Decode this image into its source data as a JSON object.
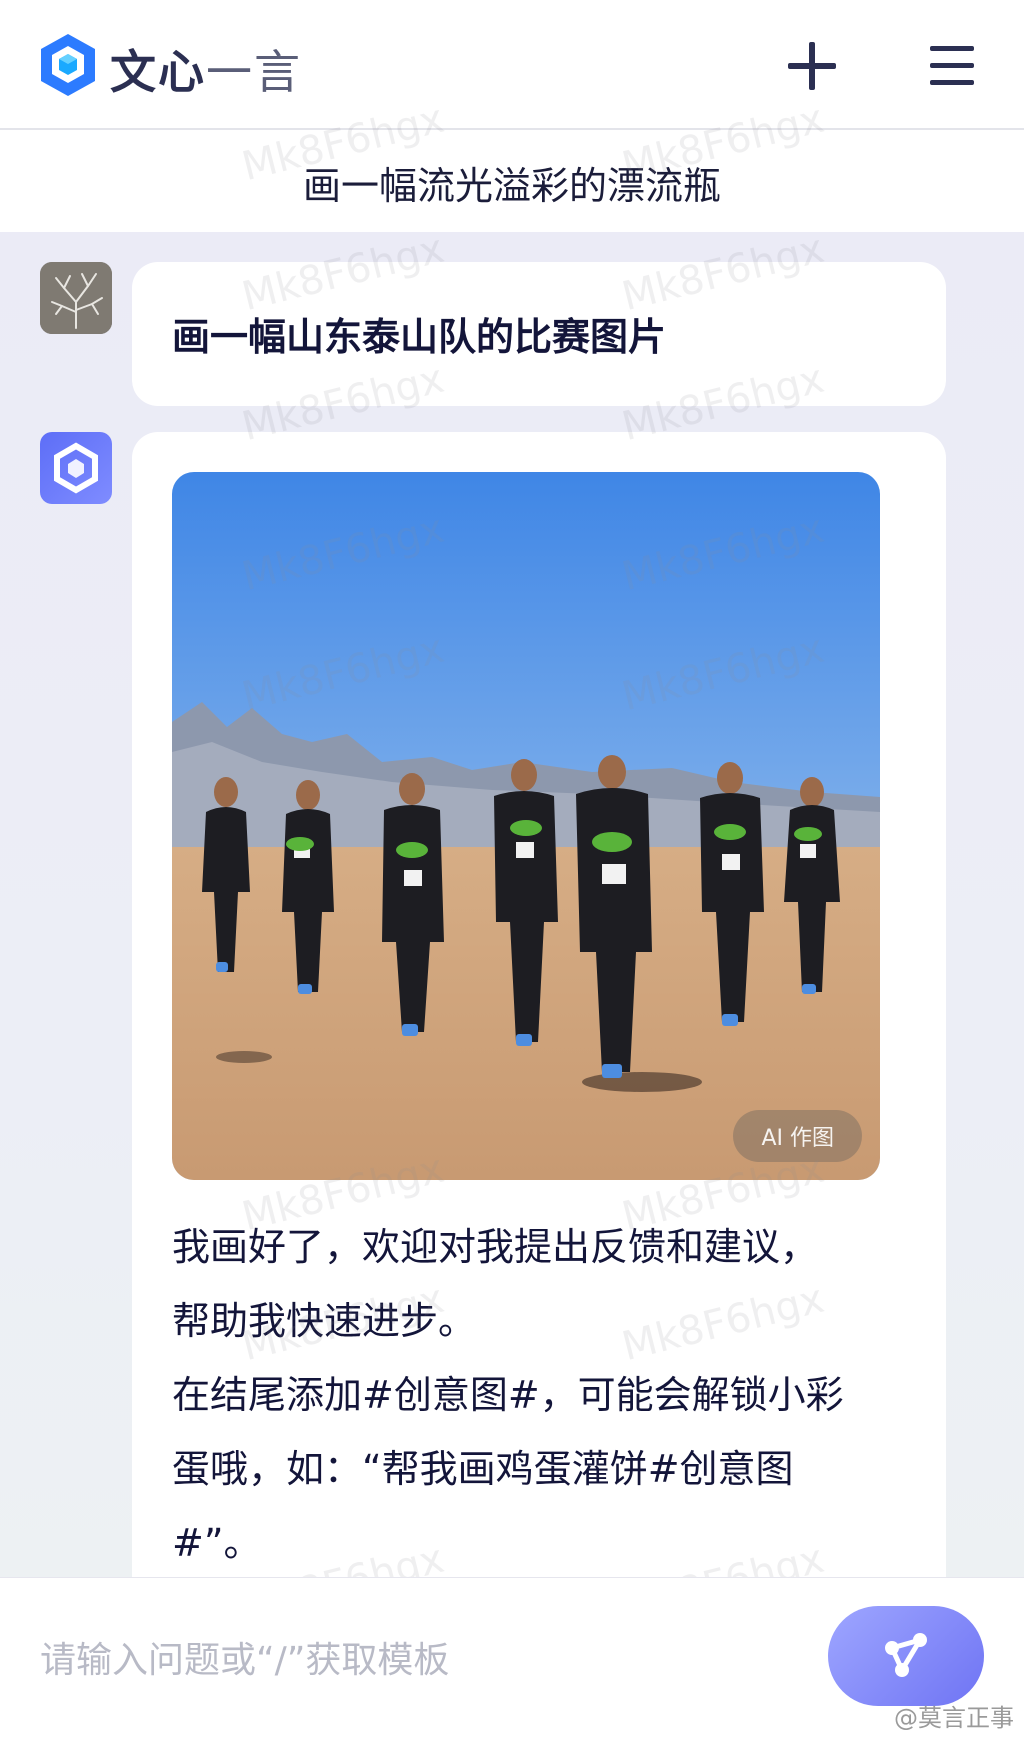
{
  "header": {
    "brand_bold": "文心",
    "brand_light": "一言"
  },
  "topic": {
    "title": "画一幅流光溢彩的漂流瓶"
  },
  "messages": {
    "user_prompt": "画一幅山东泰山队的比赛图片",
    "image_badge": "AI 作图",
    "reply_lines": [
      "我画好了，欢迎对我提出反馈和建议，",
      "帮助我快速进步。",
      "在结尾添加#创意图#，可能会解锁小彩",
      "蛋哦，如：“帮我画鸡蛋灌饼#创意图",
      "#”。"
    ]
  },
  "input": {
    "placeholder": "请输入问题或“/”获取模板"
  },
  "watermark": "Mk8F6hgx",
  "credit": "@莫言正事",
  "colors": {
    "accent": "#6f74f4",
    "brand_blue": "#2c7bff",
    "text": "#13153a"
  }
}
